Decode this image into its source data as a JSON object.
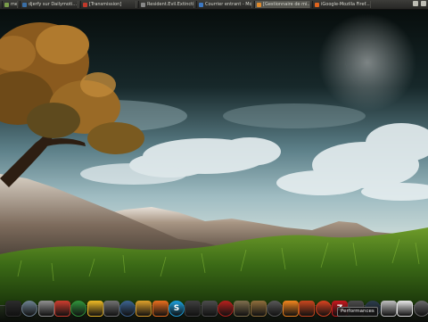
{
  "top_panel": {
    "tasks": [
      {
        "label": "me",
        "color": "#7a9c4a",
        "active": false
      },
      {
        "label": "djerfy sur Dailymoti...",
        "color": "#3a6ea5",
        "active": false
      },
      {
        "label": "[Transmission]",
        "color": "#c0392b",
        "active": false
      },
      {
        "label": "Resident.Evil.Extincti...",
        "color": "#888888",
        "active": false
      },
      {
        "label": "Courrier entrant - Mo...",
        "color": "#3d78c2",
        "active": false
      },
      {
        "label": "[Gestionnaire de mi...",
        "color": "#e08a2c",
        "active": true
      },
      {
        "label": "iGoogle-Mozilla Firef...",
        "color": "#e0641e",
        "active": false
      }
    ]
  },
  "dock": {
    "tooltip": "Performances",
    "items": [
      {
        "name": "terminal-icon",
        "glyph": "",
        "color": "#2b2b2b"
      },
      {
        "name": "package-icon",
        "glyph": "",
        "color": "#6a7d8c"
      },
      {
        "name": "settings-icon",
        "glyph": "",
        "color": "#8a8a8a"
      },
      {
        "name": "document-icon",
        "glyph": "",
        "color": "#c53b2e"
      },
      {
        "name": "help-icon",
        "glyph": "",
        "color": "#2f8f3a"
      },
      {
        "name": "chrome-icon",
        "glyph": "",
        "color": "#e6b325"
      },
      {
        "name": "edit-icon",
        "glyph": "",
        "color": "#6e6e6e"
      },
      {
        "name": "image-icon",
        "glyph": "",
        "color": "#3a5f8a"
      },
      {
        "name": "chat-icon",
        "glyph": "",
        "color": "#d59a2a"
      },
      {
        "name": "firefox-icon",
        "glyph": "",
        "color": "#e06a1e"
      },
      {
        "name": "skype-icon",
        "glyph": "S",
        "color": "#1d9ad6"
      },
      {
        "name": "music-icon",
        "glyph": "",
        "color": "#3d3d3d"
      },
      {
        "name": "calculator-icon",
        "glyph": "",
        "color": "#4a4a4a"
      },
      {
        "name": "record-icon",
        "glyph": "",
        "color": "#b0201d"
      },
      {
        "name": "gimp-icon",
        "glyph": "",
        "color": "#7a6a4a"
      },
      {
        "name": "guitar-icon",
        "glyph": "",
        "color": "#8a6b3a"
      },
      {
        "name": "film-icon",
        "glyph": "",
        "color": "#555555"
      },
      {
        "name": "vlc-icon",
        "glyph": "",
        "color": "#e8801e"
      },
      {
        "name": "media-icon",
        "glyph": "",
        "color": "#c0441e"
      },
      {
        "name": "record-player-icon",
        "glyph": "",
        "color": "#d04020"
      },
      {
        "name": "filezilla-icon",
        "glyph": "Z",
        "color": "#c0181d"
      },
      {
        "name": "monitor-icon",
        "glyph": "",
        "color": "#4a4a4a"
      },
      {
        "name": "performance-icon",
        "glyph": "",
        "color": "#2b3b4a"
      },
      {
        "name": "window-icon",
        "glyph": "",
        "color": "#b8b8b8"
      },
      {
        "name": "files-icon",
        "glyph": "",
        "color": "#e0e0e0"
      },
      {
        "name": "trash-icon",
        "glyph": "",
        "color": "#666666"
      }
    ]
  }
}
